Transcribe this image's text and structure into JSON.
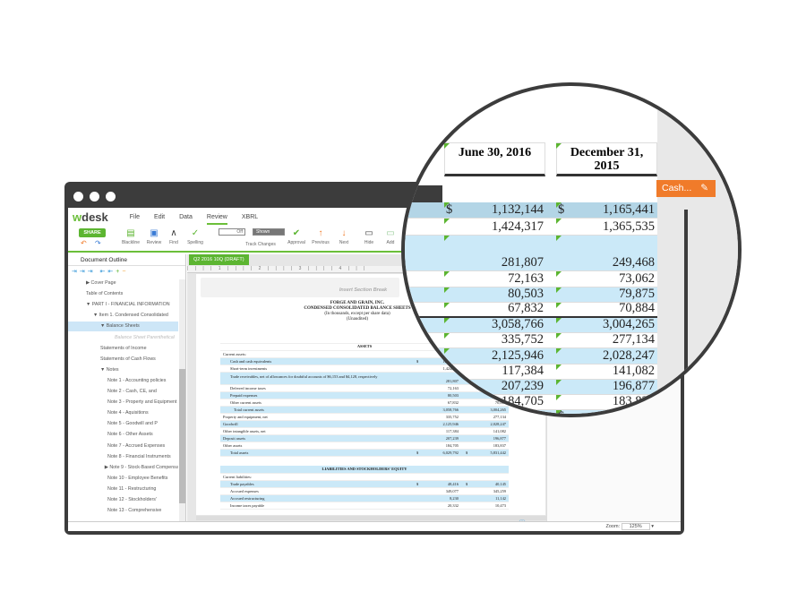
{
  "app": {
    "logo_w": "w",
    "logo_rest": "desk",
    "menu": [
      "File",
      "Edit",
      "Data",
      "Review",
      "XBRL"
    ],
    "active_menu": "Review"
  },
  "toolbar": {
    "share": "SHARE",
    "buttons": [
      "Blackline",
      "Review",
      "Find",
      "Spelling",
      "Track Changes",
      "Approval",
      "Previous",
      "Next",
      "Hide",
      "Add"
    ],
    "toggle_off": "Off",
    "toggle_shown": "Shown"
  },
  "outline": {
    "title": "Document Outline",
    "items": [
      {
        "label": "▶ Cover Page",
        "indent": 1
      },
      {
        "label": "Table of Contents",
        "indent": 1
      },
      {
        "label": "▼ PART I - FINANCIAL INFORMATION",
        "indent": 1
      },
      {
        "label": "▼ Item 1. Condensed Consolidated",
        "indent": 2
      },
      {
        "label": "▼ Balance Sheets",
        "indent": 3,
        "selected": true
      },
      {
        "label": "Balance Sheet Parenthetical",
        "indent": 5,
        "ghost": true
      },
      {
        "label": "Statements of Income",
        "indent": 3
      },
      {
        "label": "Statements of Cash Flows",
        "indent": 3
      },
      {
        "label": "▼ Notes",
        "indent": 3
      },
      {
        "label": "Note 1 - Accounting policies",
        "indent": 4
      },
      {
        "label": "Note 2 - Cash, CE, and",
        "indent": 4
      },
      {
        "label": "Note 3 - Property and Equipment",
        "indent": 4
      },
      {
        "label": "Note 4 - Aquisitions",
        "indent": 4
      },
      {
        "label": "Note 5 - Goodwill and P",
        "indent": 4
      },
      {
        "label": "Note 6 - Other Assets",
        "indent": 4
      },
      {
        "label": "Note 7 - Accrued Expenses",
        "indent": 4
      },
      {
        "label": "Note 8 - Financial Instruments",
        "indent": 4
      },
      {
        "label": "▶ Note 9 - Stock-Based Compensation",
        "indent": 3.6
      },
      {
        "label": "Note 10 - Employee Benefits",
        "indent": 4
      },
      {
        "label": "Note 11 - Restructuring",
        "indent": 4
      },
      {
        "label": "Note 12 - Stockholders'",
        "indent": 4
      },
      {
        "label": "Note 13 - Comprehensive",
        "indent": 4
      }
    ]
  },
  "document": {
    "tab": "Q2 2016 10Q (DRAFT)",
    "ruler": "| | | | 1 | | | | 2 | | | | 3 | | | | 4 | | |",
    "insert_section_break": "Insert Section Break",
    "title_lines": [
      "FORGE AND GRAIN, INC.",
      "CONDENSED CONSOLIDATED BALANCE SHEETS",
      "(In thousands, except per share data)",
      "(Unaudited)"
    ],
    "col_headers": [
      "June 30, 2016",
      "December 31, 2015"
    ],
    "assets_header": "ASSETS",
    "current_assets": "Current assets:",
    "rows": [
      {
        "label": "Cash and cash equivalents",
        "v1": "1,132,144",
        "v2": "1,165,441",
        "dollar": true,
        "blue": true,
        "in": 2
      },
      {
        "label": "Short-term investments",
        "v1": "1,424,317",
        "v2": "1,365,535",
        "in": 2
      },
      {
        "label": "Trade receivables, net of allowances for doubtful accounts of $6,153 and $4,128, respectively",
        "v1": "281,807",
        "v2": "249,468",
        "blue": true,
        "tall": true,
        "in": 2
      },
      {
        "label": "Deferred income taxes",
        "v1": "72,163",
        "v2": "73,062",
        "in": 2
      },
      {
        "label": "Prepaid expenses",
        "v1": "80,503",
        "v2": "79,875",
        "blue": true,
        "in": 2
      },
      {
        "label": "Other current assets",
        "v1": "67,832",
        "v2": "70,884",
        "in": 2
      },
      {
        "label": "Total current assets",
        "v1": "3,058,766",
        "v2": "3,004,265",
        "blue": true,
        "in": 3
      },
      {
        "label": "Property and equipment, net",
        "v1": "335,752",
        "v2": "277,134",
        "in": 0
      },
      {
        "label": "Goodwill",
        "v1": "2,125,946",
        "v2": "2,028,247",
        "blue": true,
        "in": 0
      },
      {
        "label": "Other intangible assets, net",
        "v1": "117,384",
        "v2": "141,082",
        "in": 0
      },
      {
        "label": "Deposit assets",
        "v1": "207,239",
        "v2": "196,877",
        "blue": true,
        "in": 0
      },
      {
        "label": "Other assets",
        "v1": "184,705",
        "v2": "183,837",
        "in": 0
      },
      {
        "label": "Total assets",
        "v1": "6,029,792",
        "v2": "5,831,442",
        "dollar": true,
        "blue": true,
        "in": 2
      }
    ],
    "liab_header": "LIABILITIES AND STOCKHOLDERS' EQUITY",
    "current_liabilities": "Current liabilities:",
    "liab_rows": [
      {
        "label": "Trade payables",
        "v1": "48,416",
        "v2": "40,145",
        "dollar": true,
        "blue": true
      },
      {
        "label": "Accrued expenses",
        "v1": "349,077",
        "v2": "345,259"
      },
      {
        "label": "Accrued restructuring",
        "v1": "8,230",
        "v2": "11,142",
        "blue": true
      },
      {
        "label": "Income taxes payable",
        "v1": "20,332",
        "v2": "10,473"
      }
    ]
  },
  "status": {
    "zoom_label": "Zoom:",
    "zoom_value": "125%"
  },
  "callout": {
    "label": "Cash...",
    "icon": "pencil-icon",
    "color": "#f07b2a"
  },
  "colors": {
    "accent": "#5cb531",
    "highlight": "#cbe9f8",
    "frame": "#3c3c3c"
  }
}
